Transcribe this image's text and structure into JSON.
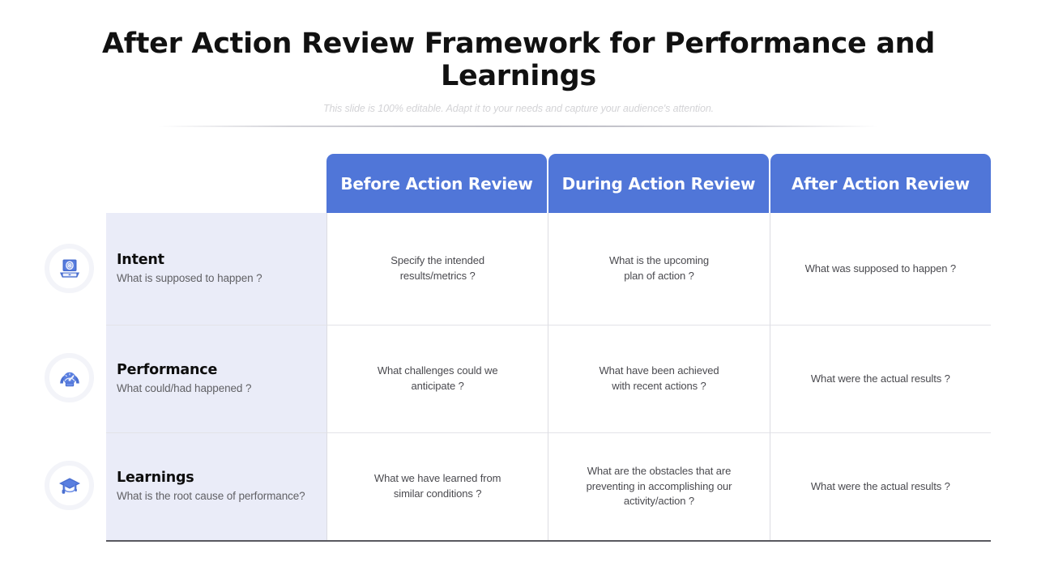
{
  "header": {
    "title": "After Action Review Framework for Performance and Learnings",
    "subtitle": "This slide is 100% editable. Adapt it to your needs and capture your audience's attention."
  },
  "theme": {
    "accent_blue": "#5076D8",
    "label_cell_bg": "#eaecf8",
    "icon_ring": "#f3f4f9",
    "bottom_rule": "#595960"
  },
  "matrix": {
    "columns": [
      {
        "label": "Before Action Review"
      },
      {
        "label": "During Action Review"
      },
      {
        "label": "After Action Review"
      }
    ],
    "rows": [
      {
        "icon": "monitor-target-icon",
        "title": "Intent",
        "subtitle": "What is supposed to happen ?",
        "cells": [
          "Specify the intended\nresults/metrics ?",
          "What is the upcoming\nplan of action ?",
          "What was supposed to happen ?"
        ]
      },
      {
        "icon": "speedometer-icon",
        "title": "Performance",
        "subtitle": "What could/had happened ?",
        "cells": [
          "What challenges could we\nanticipate ?",
          "What have been achieved\nwith recent actions ?",
          "What were the actual results ?"
        ]
      },
      {
        "icon": "graduation-cap-icon",
        "title": "Learnings",
        "subtitle": "What is the root cause of performance?",
        "cells": [
          "What we have learned from\nsimilar conditions ?",
          "What are the obstacles that are\npreventing in accomplishing our\nactivity/action ?",
          "What were the actual results ?"
        ]
      }
    ]
  }
}
